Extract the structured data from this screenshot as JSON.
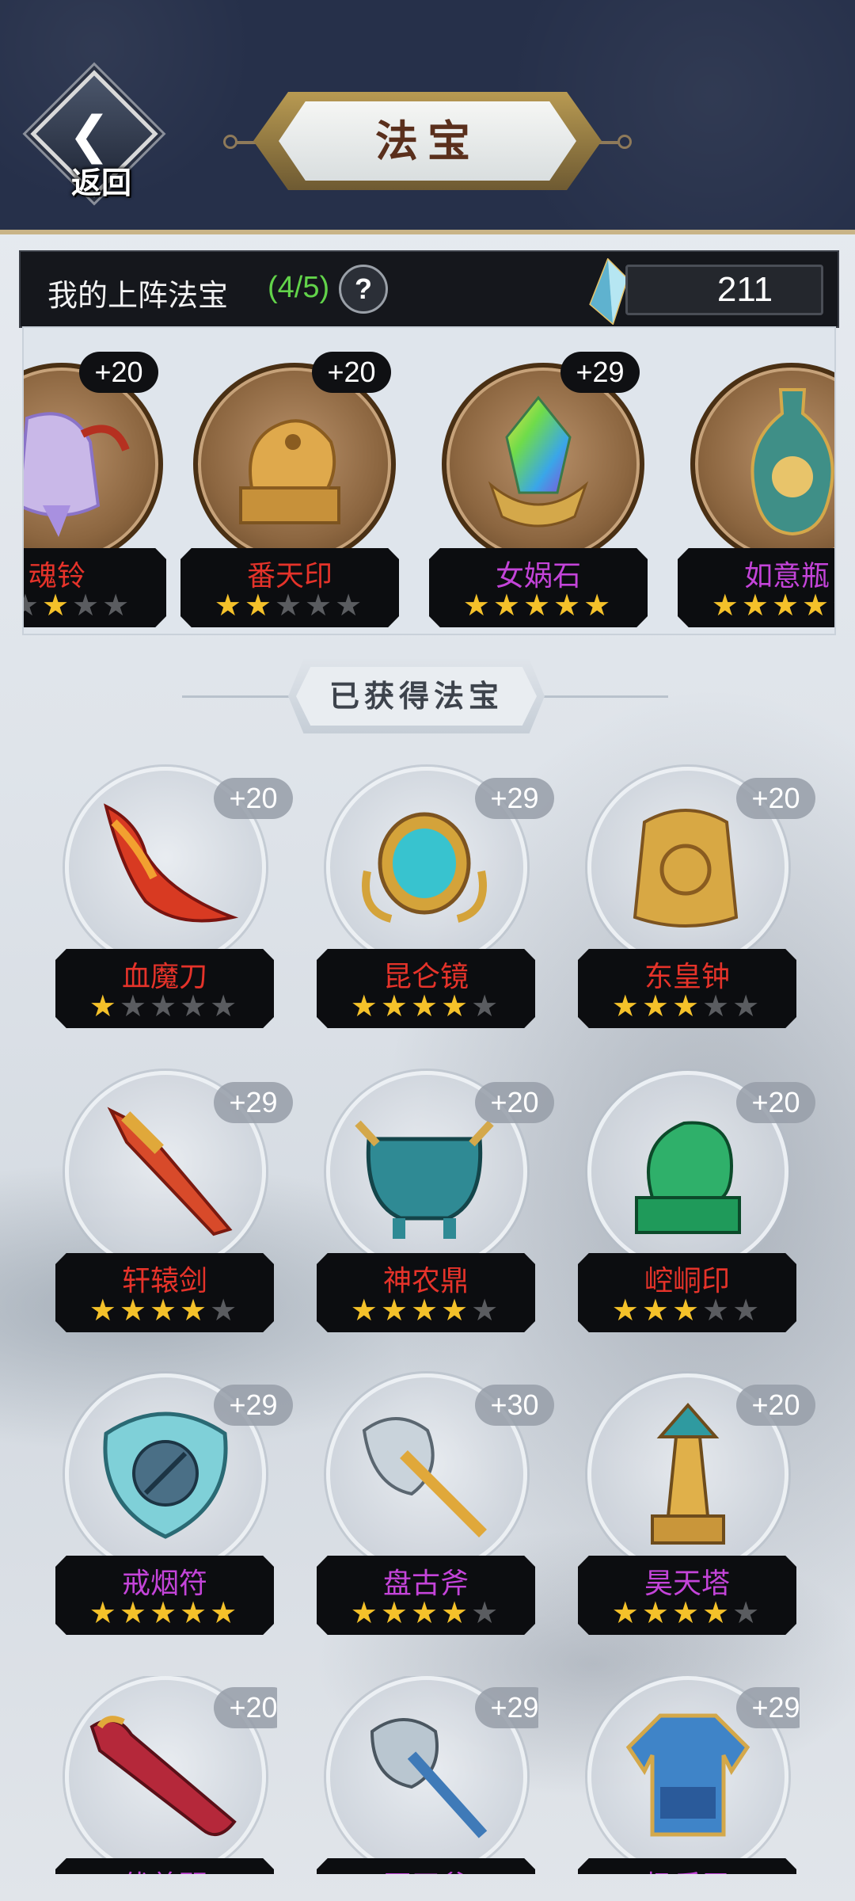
{
  "header": {
    "back_label": "返回",
    "title": "法宝"
  },
  "deploy": {
    "label": "我的上阵法宝",
    "count": "(4/5)",
    "help": "?",
    "currency": "211"
  },
  "deployed": [
    {
      "name": "魂铃",
      "level": "+20",
      "stars": 3,
      "filled": 1,
      "color": "red"
    },
    {
      "name": "番天印",
      "level": "+20",
      "stars": 5,
      "filled": 2,
      "color": "red"
    },
    {
      "name": "女娲石",
      "level": "+29",
      "stars": 5,
      "filled": 5,
      "color": "purple"
    },
    {
      "name": "如意瓶",
      "level": "",
      "stars": 4,
      "filled": 4,
      "color": "purple"
    }
  ],
  "section": {
    "title": "已获得法宝"
  },
  "owned": [
    {
      "name": "血魔刀",
      "level": "+20",
      "filled": 1,
      "color": "red"
    },
    {
      "name": "昆仑镜",
      "level": "+29",
      "filled": 4,
      "color": "red"
    },
    {
      "name": "东皇钟",
      "level": "+20",
      "filled": 3,
      "color": "red"
    },
    {
      "name": "轩辕剑",
      "level": "+29",
      "filled": 4,
      "color": "red"
    },
    {
      "name": "神农鼎",
      "level": "+20",
      "filled": 4,
      "color": "red"
    },
    {
      "name": "崆峒印",
      "level": "+20",
      "filled": 3,
      "color": "red"
    },
    {
      "name": "戒烟符",
      "level": "+29",
      "filled": 5,
      "color": "purple"
    },
    {
      "name": "盘古斧",
      "level": "+30",
      "filled": 4,
      "color": "purple"
    },
    {
      "name": "昊天塔",
      "level": "+20",
      "filled": 4,
      "color": "purple"
    },
    {
      "name": "伏羲琴",
      "level": "+20",
      "filled": 0,
      "color": "purple"
    },
    {
      "name": "开天斧",
      "level": "+29",
      "filled": 0,
      "color": "purple"
    },
    {
      "name": "极乐甲",
      "level": "+29",
      "filled": 0,
      "color": "purple"
    }
  ],
  "icons": [
    "back-arrow-icon",
    "help-icon",
    "crystal-icon",
    "star-icon"
  ],
  "colors": {
    "star_on": "#f4c12a",
    "star_off": "#5a5c60",
    "red_name": "#e5332a",
    "purple_name": "#c444d9",
    "header_bg": "#26304a"
  }
}
